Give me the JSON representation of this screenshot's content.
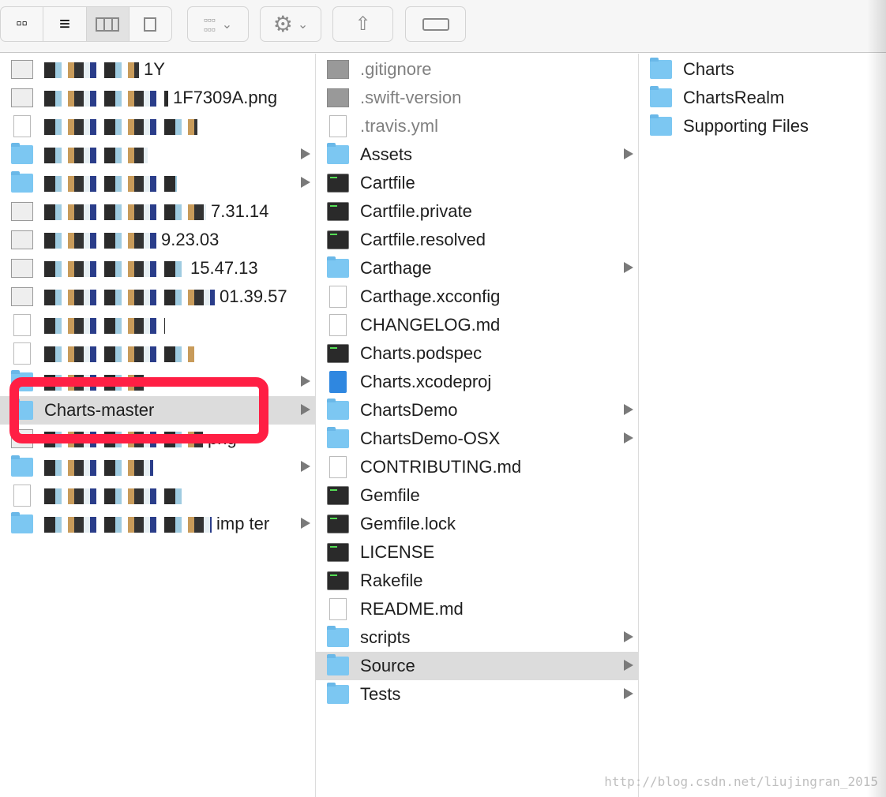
{
  "toolbar": {
    "view_modes": [
      "icon-view",
      "list-view",
      "column-view",
      "cover-flow-view"
    ],
    "active_view": "column-view",
    "buttons": [
      "arrange-menu",
      "action-menu",
      "share",
      "tags"
    ]
  },
  "columns": [
    {
      "items": [
        {
          "name": "1Y",
          "icon": "image",
          "redacted": true
        },
        {
          "name": "1F7309A.png",
          "icon": "image",
          "redacted": true
        },
        {
          "name": "",
          "icon": "text-doc",
          "redacted": true
        },
        {
          "name": "",
          "icon": "folder",
          "redacted": true,
          "folder": true
        },
        {
          "name": "",
          "icon": "folder",
          "redacted": true,
          "folder": true
        },
        {
          "name": "7.31.14",
          "icon": "image",
          "redacted": true
        },
        {
          "name": "9.23.03",
          "icon": "image",
          "redacted": true
        },
        {
          "name": "15.47.13",
          "icon": "image",
          "redacted": true
        },
        {
          "name": "01.39.57",
          "icon": "image",
          "redacted": true
        },
        {
          "name": "",
          "icon": "text-doc",
          "redacted": true
        },
        {
          "name": "",
          "icon": "doc",
          "redacted": true
        },
        {
          "name": "",
          "icon": "folder",
          "redacted": true,
          "folder": true
        },
        {
          "name": "Charts-master",
          "icon": "folder",
          "folder": true,
          "selected": true
        },
        {
          "name": "png",
          "icon": "image",
          "redacted": true
        },
        {
          "name": "",
          "icon": "folder",
          "redacted": true,
          "folder": true
        },
        {
          "name": "",
          "icon": "doc",
          "redacted": true
        },
        {
          "name": "imp ter",
          "icon": "folder",
          "redacted": true,
          "folder": true
        }
      ]
    },
    {
      "items": [
        {
          "name": ".gitignore",
          "icon": "gray",
          "dim": true
        },
        {
          "name": ".swift-version",
          "icon": "gray",
          "dim": true
        },
        {
          "name": ".travis.yml",
          "icon": "doc",
          "dim": true
        },
        {
          "name": "Assets",
          "icon": "folder",
          "folder": true
        },
        {
          "name": "Cartfile",
          "icon": "exec"
        },
        {
          "name": "Cartfile.private",
          "icon": "exec"
        },
        {
          "name": "Cartfile.resolved",
          "icon": "exec"
        },
        {
          "name": "Carthage",
          "icon": "folder",
          "folder": true
        },
        {
          "name": "Carthage.xcconfig",
          "icon": "doc"
        },
        {
          "name": "CHANGELOG.md",
          "icon": "doc"
        },
        {
          "name": "Charts.podspec",
          "icon": "exec"
        },
        {
          "name": "Charts.xcodeproj",
          "icon": "xcodeproj"
        },
        {
          "name": "ChartsDemo",
          "icon": "folder",
          "folder": true
        },
        {
          "name": "ChartsDemo-OSX",
          "icon": "folder",
          "folder": true
        },
        {
          "name": "CONTRIBUTING.md",
          "icon": "doc"
        },
        {
          "name": "Gemfile",
          "icon": "exec"
        },
        {
          "name": "Gemfile.lock",
          "icon": "exec"
        },
        {
          "name": "LICENSE",
          "icon": "exec"
        },
        {
          "name": "Rakefile",
          "icon": "exec"
        },
        {
          "name": "README.md",
          "icon": "doc"
        },
        {
          "name": "scripts",
          "icon": "folder",
          "folder": true
        },
        {
          "name": "Source",
          "icon": "folder",
          "folder": true,
          "selected": true
        },
        {
          "name": "Tests",
          "icon": "folder",
          "folder": true
        }
      ]
    },
    {
      "items": [
        {
          "name": "Charts",
          "icon": "folder"
        },
        {
          "name": "ChartsRealm",
          "icon": "folder"
        },
        {
          "name": "Supporting Files",
          "icon": "folder"
        }
      ]
    }
  ],
  "highlight_color": "#ff1f44",
  "watermark": "http://blog.csdn.net/liujingran_2015"
}
